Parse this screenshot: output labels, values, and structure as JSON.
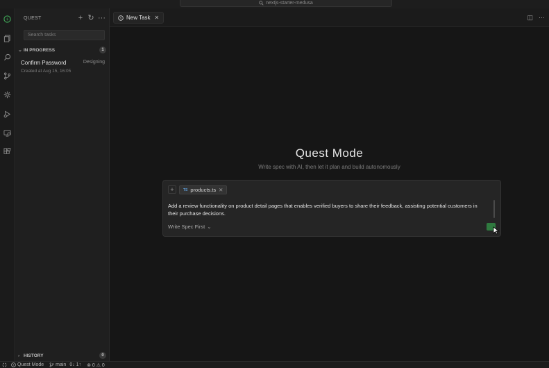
{
  "titlebar": {
    "search_text": "nextjs-starter-medusa"
  },
  "sidebar": {
    "header": "QUEST",
    "search_placeholder": "Search tasks",
    "in_progress": {
      "label": "IN PROGRESS",
      "count": "1"
    },
    "tasks": [
      {
        "title": "Confirm Password",
        "status": "Designing",
        "meta": "Created at Aug 15, 16:05"
      }
    ],
    "history": {
      "label": "HISTORY",
      "count": "0"
    }
  },
  "editor": {
    "tab_label": "New Task"
  },
  "main": {
    "title": "Quest Mode",
    "subtitle": "Write spec with AI, then let it plan and build autonomously",
    "composer": {
      "chip_badge": "TS",
      "chip_file": "products.ts",
      "prompt": "Add a review functionality on product detail pages that enables verified buyers to share their feedback, assisting potential customers in their purchase decisions.",
      "mode": "Write Spec First"
    },
    "accent_color": "#2f7a3f"
  },
  "statusbar": {
    "mode": "Quest Mode",
    "branch": "main",
    "sync": "0↓ 1↑",
    "problems": "⊗ 0 ⚠ 0"
  }
}
